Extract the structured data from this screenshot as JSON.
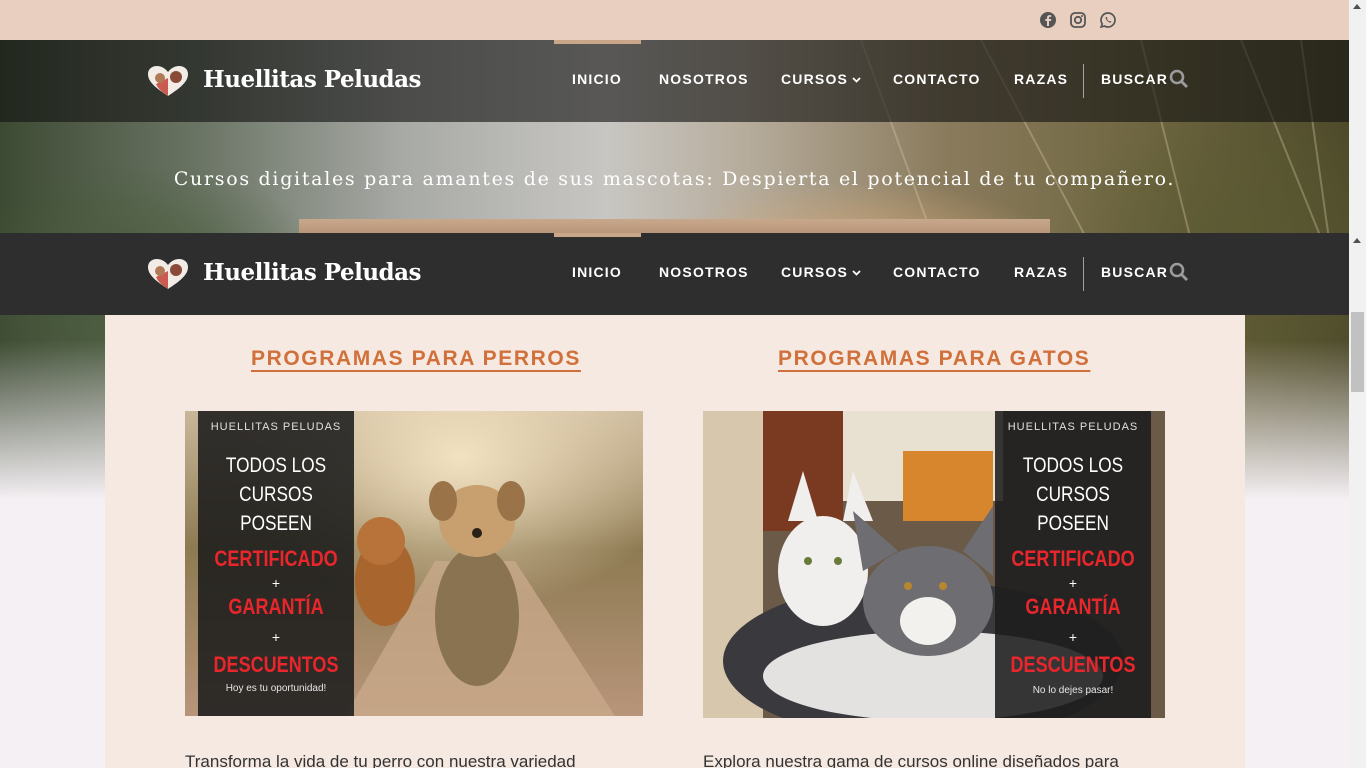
{
  "social": {
    "items": [
      {
        "name": "facebook-icon"
      },
      {
        "name": "instagram-icon"
      },
      {
        "name": "whatsapp-icon"
      }
    ]
  },
  "header": {
    "logo_text": "Huellitas Peludas",
    "menu": {
      "inicio": "INICIO",
      "nosotros": "NOSOTROS",
      "cursos": "CURSOS",
      "contacto": "CONTACTO",
      "razas": "RAZAS",
      "buscar": "BUSCAR"
    }
  },
  "hero": {
    "tagline": "Cursos digitales para amantes de sus mascotas: Despierta el potencial de tu compañero."
  },
  "programs": {
    "dogs": {
      "title": "PROGRAMAS PARA PERROS",
      "banner_brand": "HUELLITAS PELUDAS",
      "banner_line1": "TODOS LOS",
      "banner_line2": "CURSOS POSEEN",
      "banner_red1": "CERTIFICADO",
      "banner_plus": "+",
      "banner_red2": "GARANTÍA",
      "banner_red3": "DESCUENTOS",
      "banner_foot": "Hoy es tu oportunidad!",
      "description": "Transforma la vida de tu perro con nuestra variedad"
    },
    "cats": {
      "title": "PROGRAMAS PARA GATOS",
      "banner_brand": "HUELLITAS PELUDAS",
      "banner_line1": "TODOS LOS",
      "banner_line2": "CURSOS POSEEN",
      "banner_red1": "CERTIFICADO",
      "banner_plus": "+",
      "banner_red2": "GARANTÍA",
      "banner_red3": "DESCUENTOS",
      "banner_foot": "No lo dejes pasar!",
      "description": "Explora nuestra gama de cursos online diseñados para"
    }
  },
  "colors": {
    "topbar": "#e8cfc0",
    "accent": "#d0703a",
    "panel": "#f6e9e2",
    "banner_red": "#e8262c"
  }
}
